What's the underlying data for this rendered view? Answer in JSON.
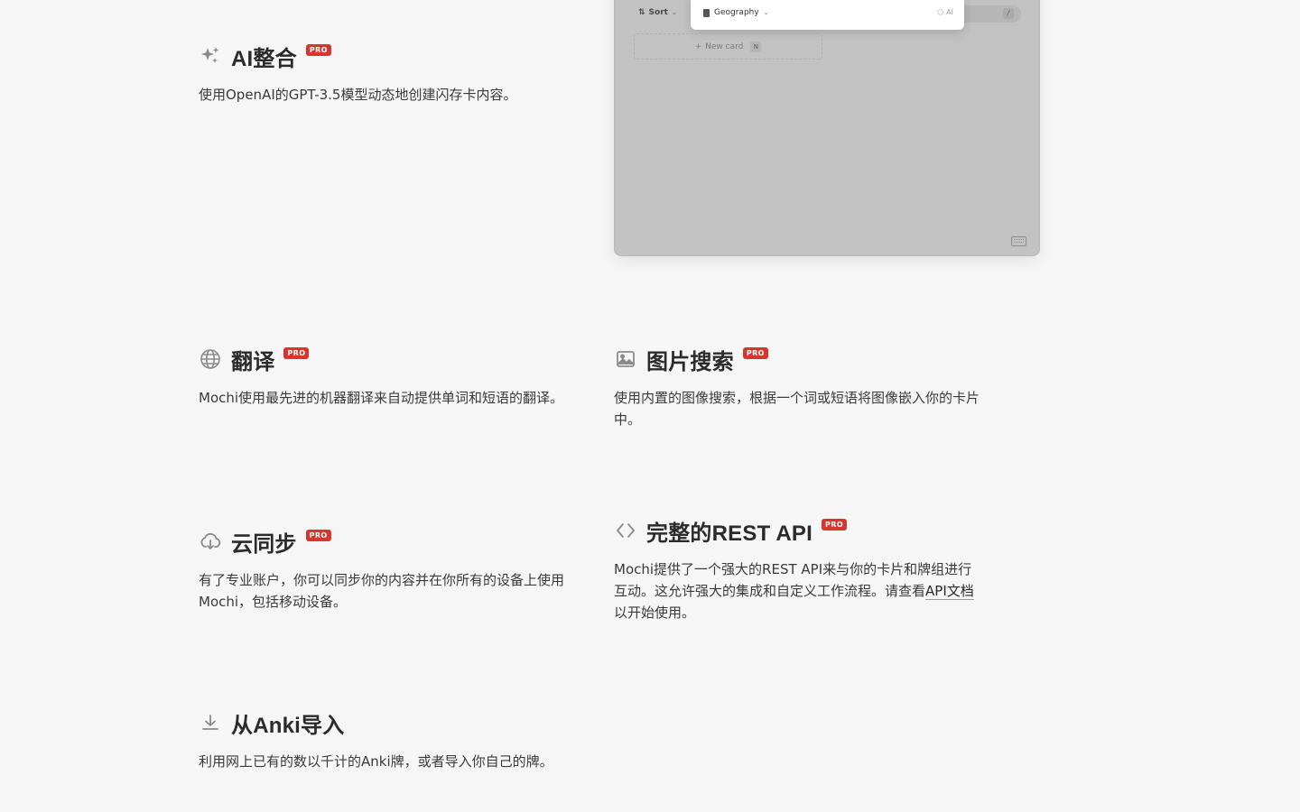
{
  "preview": {
    "sort_label": "Sort",
    "deck_name": "Geography",
    "ai_label": "AI",
    "search_shortcut": "/",
    "new_card_label": "New card",
    "new_card_shortcut": "N"
  },
  "badge": "PRO",
  "features": {
    "ai": {
      "title": "AI整合",
      "pro": true,
      "icon": "sparkles-icon",
      "description": "使用OpenAI的GPT-3.5模型动态地创建闪存卡内容。"
    },
    "translate": {
      "title": "翻译",
      "pro": true,
      "icon": "globe-icon",
      "description": "Mochi使用最先进的机器翻译来自动提供单词和短语的翻译。"
    },
    "image_search": {
      "title": "图片搜索",
      "pro": true,
      "icon": "image-icon",
      "description": "使用内置的图像搜索，根据一个词或短语将图像嵌入你的卡片中。"
    },
    "sync": {
      "title": "云同步",
      "pro": true,
      "icon": "cloud-download-icon",
      "description": "有了专业账户，你可以同步你的内容并在你所有的设备上使用Mochi，包括移动设备。"
    },
    "api": {
      "title": "完整的REST API",
      "pro": true,
      "icon": "code-icon",
      "description_before": "Mochi提供了一个强大的REST API来与你的卡片和牌组进行互动。这允许强大的集成和自定义工作流程。请查看",
      "link_text": "API文档",
      "description_after": "以开始使用。"
    },
    "anki": {
      "title": "从Anki导入",
      "pro": false,
      "icon": "download-icon",
      "description": "利用网上已有的数以千计的Anki牌，或者导入你自己的牌。"
    }
  }
}
